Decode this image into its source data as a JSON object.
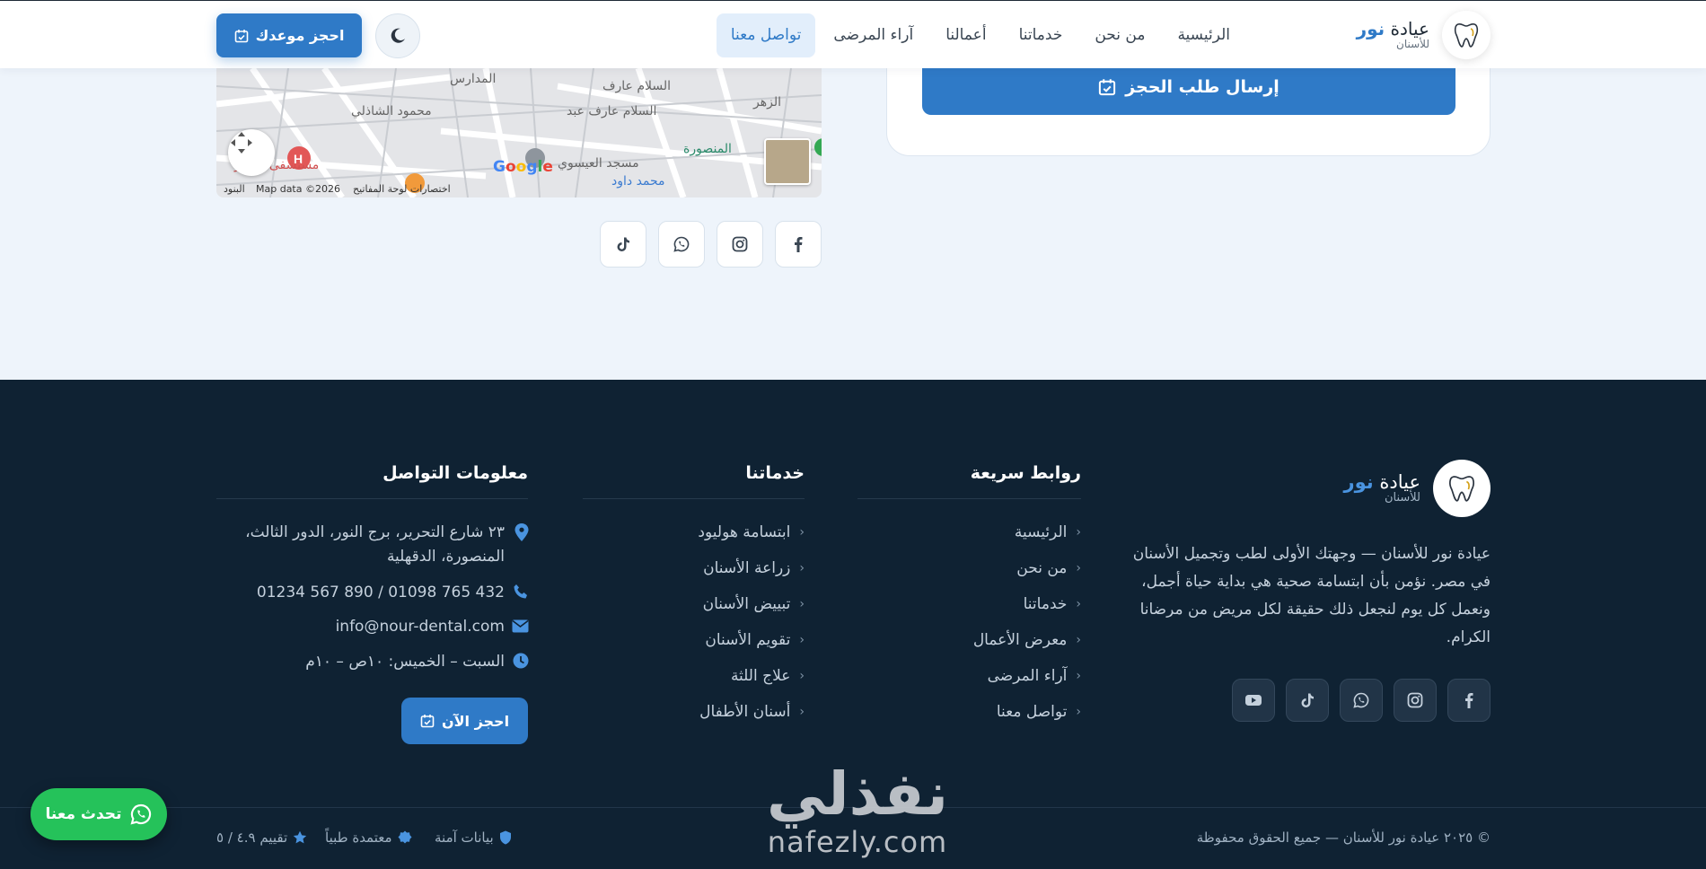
{
  "header": {
    "logo_name": "عيادة",
    "logo_highlight": "نور",
    "logo_sub": "للأسنان",
    "nav": [
      {
        "label": "الرئيسية",
        "active": false
      },
      {
        "label": "من نحن",
        "active": false
      },
      {
        "label": "خدماتنا",
        "active": false
      },
      {
        "label": "أعمالنا",
        "active": false
      },
      {
        "label": "آراء المرضى",
        "active": false
      },
      {
        "label": "تواصل معنا",
        "active": true
      }
    ],
    "theme_icon": "moon-icon",
    "book_button": "احجز موعدك"
  },
  "form": {
    "submit_label": "إرسال طلب الحجز"
  },
  "map": {
    "labels": [
      "السلام عارف",
      "السلام عارف عبد",
      "المنصورة",
      "مسجد العيسوي",
      "محمود الشاذلي",
      "مستشفى الصدر",
      "الزهر",
      "المدارس",
      "محمد داود"
    ],
    "google": "Google",
    "attribution_terms": "البنود",
    "attribution_data": "Map data ©2026",
    "attribution_shortcuts": "اختصارات لوحة المفاتيح"
  },
  "social_top": [
    "facebook-icon",
    "instagram-icon",
    "whatsapp-icon",
    "tiktok-icon"
  ],
  "footer": {
    "logo_name": "عيادة",
    "logo_highlight": "نور",
    "logo_sub": "للأسنان",
    "about": "عيادة نور للأسنان — وجهتك الأولى لطب وتجميل الأسنان في مصر. نؤمن بأن ابتسامة صحية هي بداية حياة أجمل، ونعمل كل يوم لنجعل ذلك حقيقة لكل مريض من مرضانا الكرام.",
    "social": [
      "facebook-icon",
      "instagram-icon",
      "whatsapp-icon",
      "tiktok-icon",
      "youtube-icon"
    ],
    "quick_links": {
      "title": "روابط سريعة",
      "items": [
        "الرئيسية",
        "من نحن",
        "خدماتنا",
        "معرض الأعمال",
        "آراء المرضى",
        "تواصل معنا"
      ]
    },
    "services": {
      "title": "خدماتنا",
      "items": [
        "ابتسامة هوليود",
        "زراعة الأسنان",
        "تبييض الأسنان",
        "تقويم الأسنان",
        "علاج اللثة",
        "أسنان الأطفال"
      ]
    },
    "contact": {
      "title": "معلومات التواصل",
      "address": "٢٣ شارع التحرير، برج النور، الدور الثالث، المنصورة، الدقهلية",
      "phone": "01234 567 890 / 01098 765 432",
      "email": "info@nour-dental.com",
      "hours": "السبت – الخميس: ١٠ص – ١٠م",
      "book_now": "احجز الآن"
    },
    "copyright": "© ٢٠٢٥ عيادة نور للأسنان — جميع الحقوق محفوظة",
    "badges": [
      "بيانات آمنة",
      "معتمدة طبياً",
      "تقييم ٤.٩ / ٥"
    ]
  },
  "whatsapp_button": "تحدث معنا",
  "watermark": {
    "arabic": "نفذلي",
    "latin": "nafezly.com"
  },
  "colors": {
    "primary": "#2f7ac7",
    "footer_bg": "#0f2233",
    "whatsapp": "#25c25a",
    "page_bg": "#eef4fb"
  }
}
